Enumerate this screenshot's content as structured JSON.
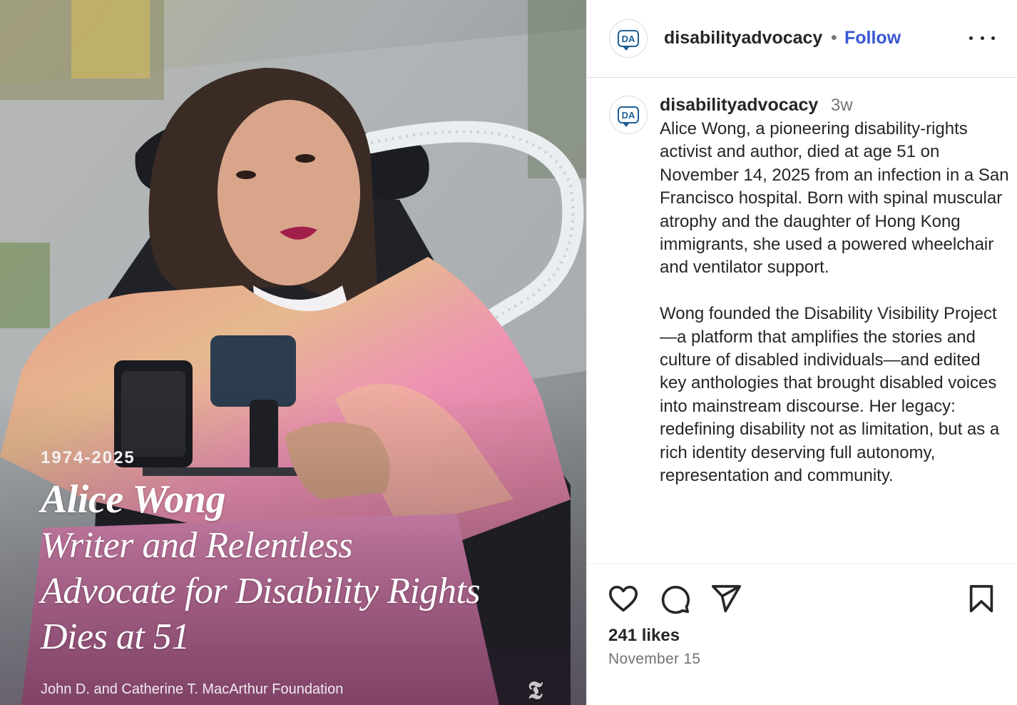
{
  "post": {
    "image": {
      "years": "1974-2025",
      "name": "Alice Wong",
      "subtitle_lines": [
        "Writer and Relentless",
        "Advocate for Disability Rights",
        "Dies at 51"
      ],
      "credit": "John D. and Catherine T. MacArthur Foundation",
      "watermark": "𝕿"
    },
    "header": {
      "avatar_text": "DA",
      "username": "disabilityadvocacy",
      "separator": "•",
      "follow_label": "Follow",
      "more_icon": "more-horizontal-icon"
    },
    "caption": {
      "avatar_text": "DA",
      "username": "disabilityadvocacy",
      "time_ago": "3w",
      "text": "Alice Wong, a pioneering disability-rights activist and author, died at age 51 on November 14, 2025 from an infection in a San Francisco hospital.  Born with spinal muscular atrophy and the daughter of Hong Kong immigrants, she used a powered wheelchair and ventilator support.\n\nWong founded the Disability Visibility Project—a platform that amplifies the stories and culture of disabled individuals—and edited key anthologies that brought disabled voices into mainstream discourse. Her legacy: redefining disability not as limitation, but as a rich identity deserving full autonomy, representation and community."
    },
    "actions": {
      "icons": [
        "heart-icon",
        "comment-icon",
        "share-icon",
        "bookmark-icon"
      ],
      "likes": "241 likes",
      "date": "November 15"
    }
  },
  "colors": {
    "follow": "#3a58d6",
    "brand_logo": "#1d5f96",
    "muted_text": "#737373"
  }
}
